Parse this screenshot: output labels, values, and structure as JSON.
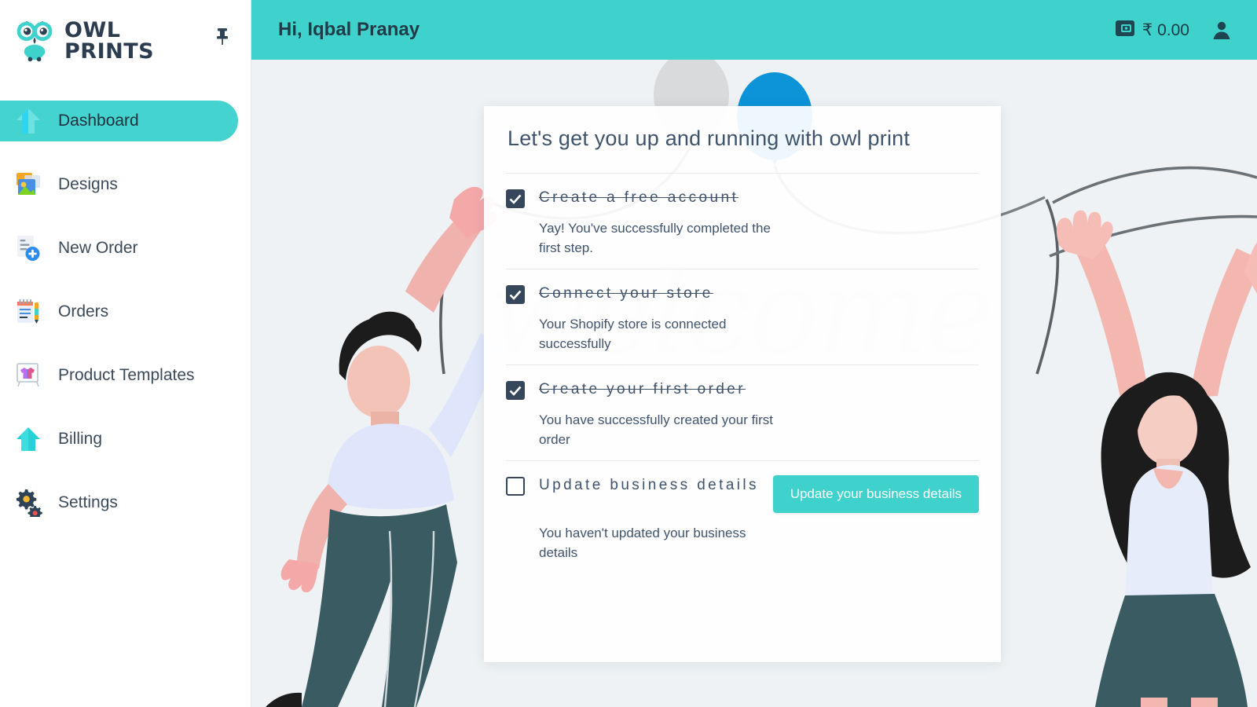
{
  "brand": {
    "line1": "OWL",
    "line2": "PRINTS",
    "logo_icon": "owl-icon",
    "pin_icon": "pin-icon"
  },
  "sidebar": {
    "items": [
      {
        "label": "Dashboard",
        "icon": "home-arrow-icon",
        "active": true
      },
      {
        "label": "Designs",
        "icon": "images-icon",
        "active": false
      },
      {
        "label": "New Order",
        "icon": "document-plus-icon",
        "active": false
      },
      {
        "label": "Orders",
        "icon": "notepad-icon",
        "active": false
      },
      {
        "label": "Product Templates",
        "icon": "tshirt-frame-icon",
        "active": false
      },
      {
        "label": "Billing",
        "icon": "home-icon",
        "active": false
      },
      {
        "label": "Settings",
        "icon": "gears-icon",
        "active": false
      }
    ]
  },
  "topbar": {
    "greeting": "Hi, Iqbal Pranay",
    "wallet_icon": "wallet-icon",
    "wallet_amount": "₹ 0.00",
    "avatar_icon": "user-icon",
    "background_color": "#3fd2cd"
  },
  "background": {
    "watermark_text": "welcome",
    "balloon_gray": "#d8dadb",
    "balloon_blue": "#0d93d8",
    "stage_color": "#eef2f4"
  },
  "card": {
    "title": "Let's get you up and running with owl print",
    "steps": [
      {
        "title": "Create a free account",
        "description": "Yay! You've successfully completed the first step.",
        "checked": true,
        "action": null
      },
      {
        "title": "Connect your store",
        "description": "Your Shopify store is connected successfully",
        "checked": true,
        "action": null
      },
      {
        "title": "Create your first order",
        "description": "You have successfully created your first order",
        "checked": true,
        "action": null
      },
      {
        "title": "Update business details",
        "description": "You haven't updated your business details",
        "checked": false,
        "action": "Update your business details"
      }
    ]
  },
  "colors": {
    "accent": "#3fd2cd",
    "accent_active": "#45d3cf",
    "text_dark": "#36475c",
    "text_body": "#3f536b"
  }
}
